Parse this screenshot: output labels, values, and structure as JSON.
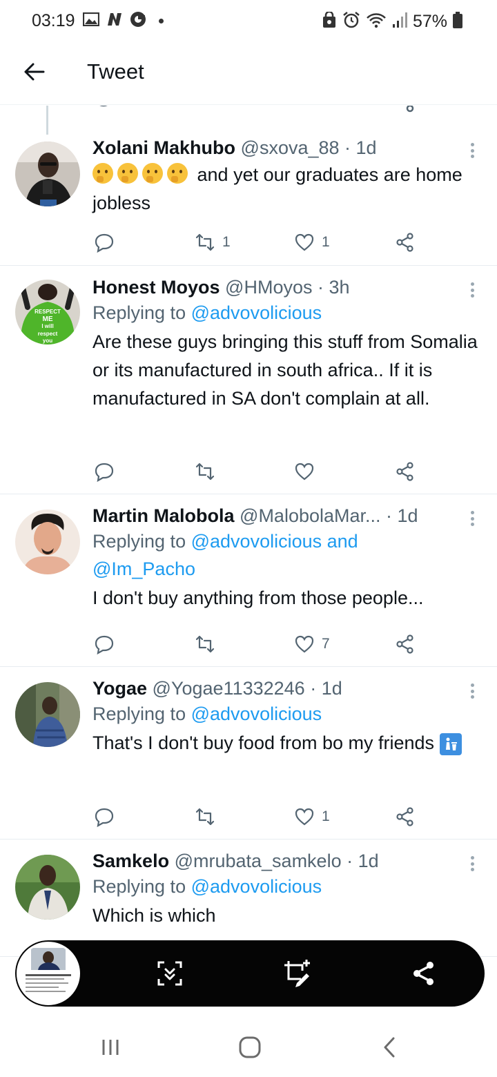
{
  "status_bar": {
    "time": "03:19",
    "battery": "57%",
    "icons_left": [
      "image-icon",
      "n-app-icon",
      "opera-icon",
      "dot"
    ],
    "icons_right": [
      "lock-saver-icon",
      "alarm-icon",
      "wifi-icon",
      "signal-icon",
      "battery-icon"
    ]
  },
  "header": {
    "title": "Tweet"
  },
  "tweets": [
    {
      "name": "Xolani Makhubo",
      "handle": "@sxova_88",
      "time": "· 1d",
      "replying_prefix": "",
      "replying_mentions": "",
      "replying_mentions_2": "",
      "text_emoji": "🤔🤔🤔🤔",
      "text": "and yet our graduates are home jobless",
      "replies": "",
      "retweets": "1",
      "likes": "1"
    },
    {
      "name": "Honest Moyos",
      "handle": "@HMoyos",
      "time": "· 3h",
      "replying_prefix": "Replying to",
      "replying_mentions": "@advovolicious",
      "text": "Are these guys bringing this stuff from Somalia or its manufactured in south africa.. If it is manufactured in SA don't complain at all.",
      "replies": "",
      "retweets": "",
      "likes": "",
      "avatar_text": [
        "RESPECT",
        "ME",
        "I will",
        "respect",
        "you"
      ]
    },
    {
      "name": "Martin Malobola",
      "handle": "@MalobolaMar...",
      "time": "· 1d",
      "replying_prefix": "Replying to",
      "replying_mentions": "@advovolicious and",
      "replying_mentions_2": "@Im_Pacho",
      "text": "I don't buy anything from those people...",
      "replies": "",
      "retweets": "",
      "likes": "7"
    },
    {
      "name": "Yogae",
      "handle": "@Yogae11332246",
      "time": "· 1d",
      "replying_prefix": "Replying to",
      "replying_mentions": "@advovolicious",
      "text": "That's I don't buy food from bo my friends",
      "text_emoji": "🚮",
      "replies": "",
      "retweets": "",
      "likes": "1"
    },
    {
      "name": "Samkelo",
      "handle": "@mrubata_samkelo",
      "time": "· 1d",
      "replying_prefix": "Replying to",
      "replying_mentions": "@advovolicious",
      "text": "Which is which"
    }
  ],
  "floating_toolbar": {
    "buttons": [
      "expand-capture-icon",
      "edit-crop-icon",
      "share-icon"
    ]
  },
  "nav_bar": {
    "buttons": [
      "recents-icon",
      "home-icon",
      "back-icon"
    ]
  },
  "colors": {
    "accent": "#1d9bf0",
    "secondary_text": "#536471",
    "divider": "#e7ecf0",
    "toolbar_bg": "#050505"
  }
}
